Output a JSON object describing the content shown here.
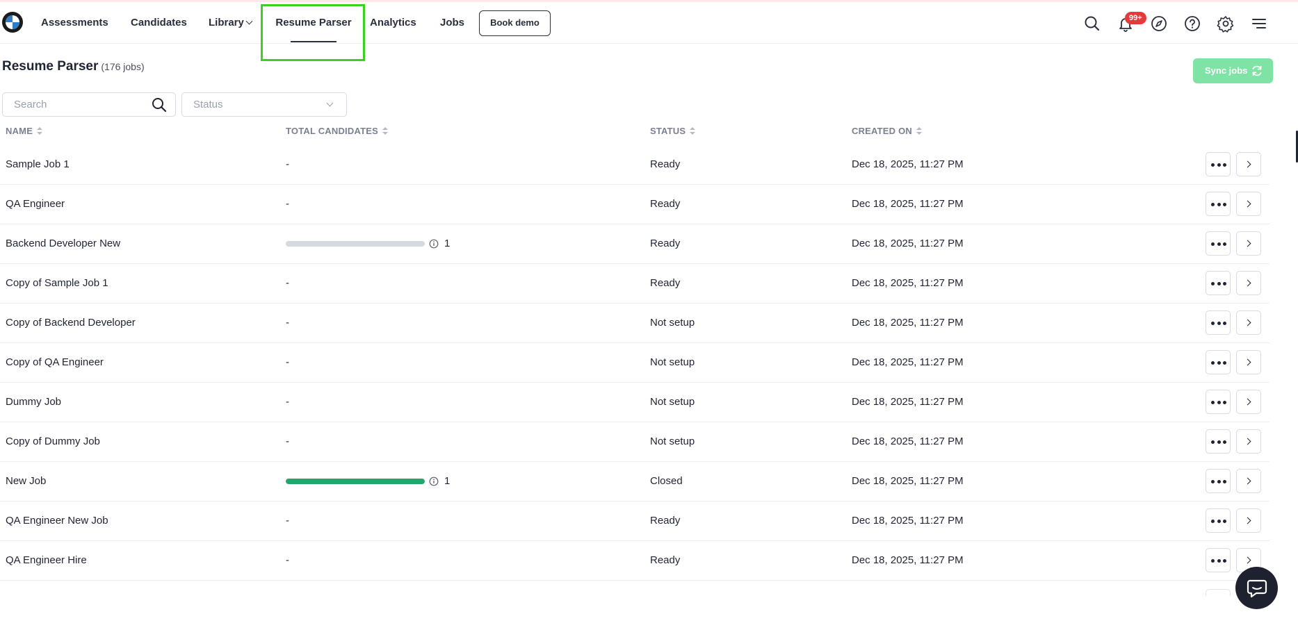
{
  "nav": {
    "items": [
      {
        "label": "Assessments"
      },
      {
        "label": "Candidates"
      },
      {
        "label": "Library"
      },
      {
        "label": "Resume Parser"
      },
      {
        "label": "Analytics"
      },
      {
        "label": "Jobs"
      }
    ],
    "book_demo": "Book demo",
    "notification_badge": "99+",
    "icons": [
      "search-icon",
      "bell-icon",
      "compass-icon",
      "help-icon",
      "gear-icon",
      "menu-icon"
    ]
  },
  "page": {
    "title": "Resume Parser",
    "count": "(176 jobs)",
    "sync_label": "Sync jobs"
  },
  "filters": {
    "search_placeholder": "Search",
    "status_placeholder": "Status"
  },
  "table": {
    "columns": [
      "NAME",
      "TOTAL CANDIDATES",
      "STATUS",
      "CREATED ON"
    ],
    "rows": [
      {
        "name": "Sample Job 1",
        "total": "-",
        "status": "Ready",
        "created": "Dec 18, 2025, 11:27 PM"
      },
      {
        "name": "QA Engineer",
        "total": "-",
        "status": "Ready",
        "created": "Dec 18, 2025, 11:27 PM"
      },
      {
        "name": "Backend Developer New",
        "total": "1",
        "progress": 0,
        "status": "Ready",
        "created": "Dec 18, 2025, 11:27 PM"
      },
      {
        "name": "Copy of Sample Job 1",
        "total": "-",
        "status": "Ready",
        "created": "Dec 18, 2025, 11:27 PM"
      },
      {
        "name": "Copy of Backend Developer",
        "total": "-",
        "status": "Not setup",
        "created": "Dec 18, 2025, 11:27 PM"
      },
      {
        "name": "Copy of QA Engineer",
        "total": "-",
        "status": "Not setup",
        "created": "Dec 18, 2025, 11:27 PM"
      },
      {
        "name": "Dummy Job",
        "total": "-",
        "status": "Not setup",
        "created": "Dec 18, 2025, 11:27 PM"
      },
      {
        "name": "Copy of Dummy Job",
        "total": "-",
        "status": "Not setup",
        "created": "Dec 18, 2025, 11:27 PM"
      },
      {
        "name": "New Job",
        "total": "1",
        "progress": 1,
        "status": "Closed",
        "created": "Dec 18, 2025, 11:27 PM"
      },
      {
        "name": "QA Engineer New Job",
        "total": "-",
        "status": "Ready",
        "created": "Dec 18, 2025, 11:27 PM"
      },
      {
        "name": "QA Engineer Hire",
        "total": "-",
        "status": "Ready",
        "created": "Dec 18, 2025, 11:27 PM"
      }
    ]
  },
  "colors": {
    "accent_highlight": "#3ad11f",
    "sync_button": "#7fe3a6",
    "progress_fill": "#22a66b",
    "badge": "#e33b3b"
  }
}
